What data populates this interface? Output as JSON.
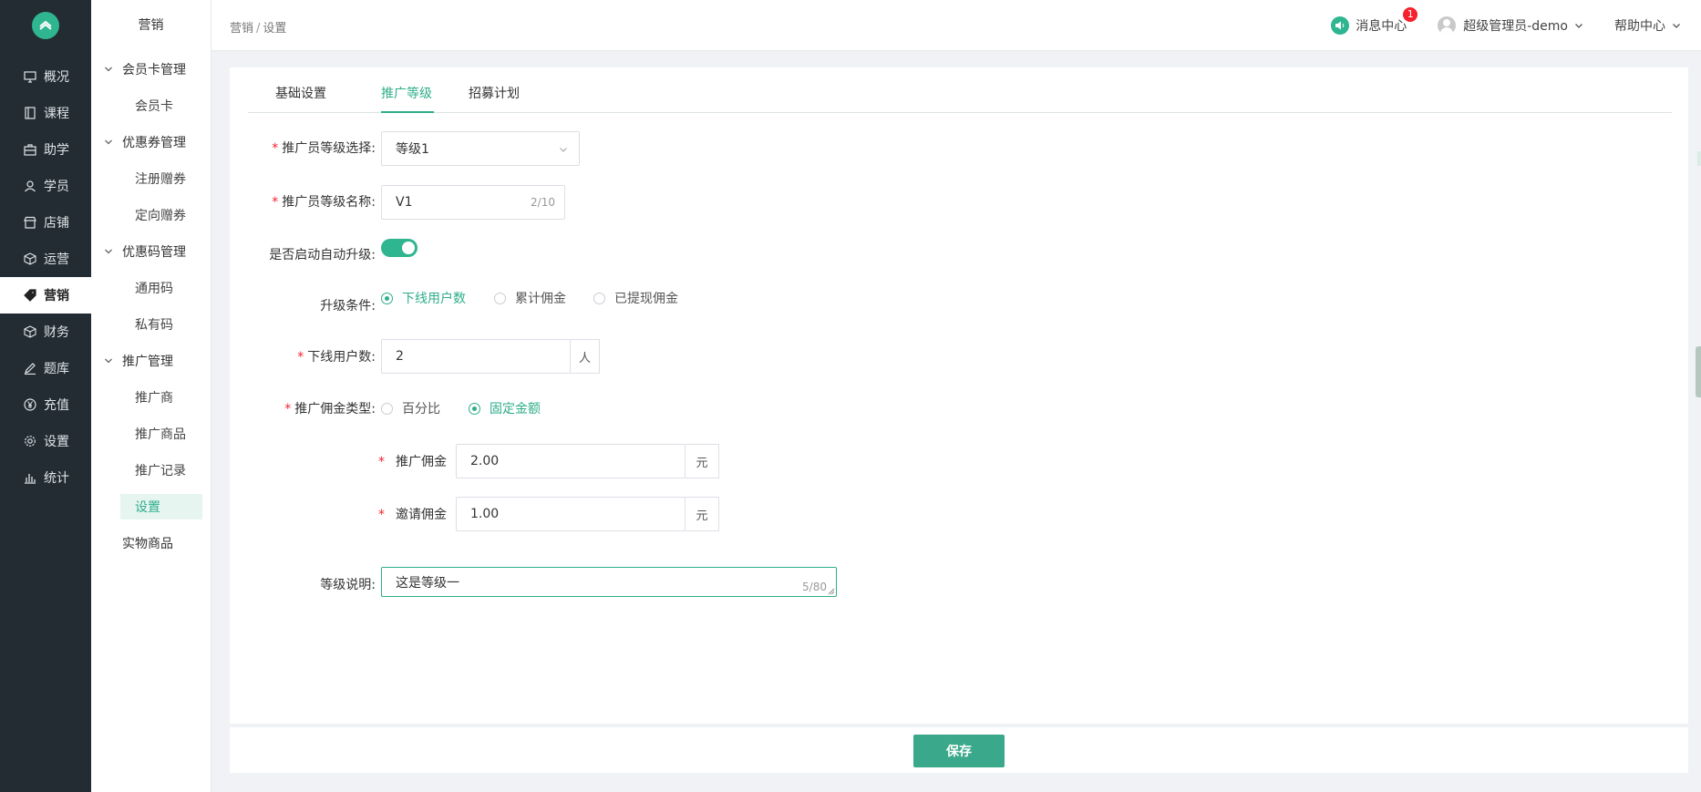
{
  "sidebar": {
    "items": [
      {
        "label": "概况",
        "icon": "monitor-icon"
      },
      {
        "label": "课程",
        "icon": "book-icon"
      },
      {
        "label": "助学",
        "icon": "briefcase-icon"
      },
      {
        "label": "学员",
        "icon": "user-icon"
      },
      {
        "label": "店铺",
        "icon": "store-icon"
      },
      {
        "label": "运营",
        "icon": "cube-icon"
      },
      {
        "label": "营销",
        "icon": "tag-icon"
      },
      {
        "label": "财务",
        "icon": "cube-icon"
      },
      {
        "label": "题库",
        "icon": "pen-icon"
      },
      {
        "label": "充值",
        "icon": "yen-icon"
      },
      {
        "label": "设置",
        "icon": "gear-icon"
      },
      {
        "label": "统计",
        "icon": "bar-chart-icon"
      }
    ],
    "active": "营销"
  },
  "submenu": {
    "title": "营销",
    "groups": [
      {
        "label": "会员卡管理",
        "items": [
          "会员卡"
        ]
      },
      {
        "label": "优惠券管理",
        "items": [
          "注册赠券",
          "定向赠券"
        ]
      },
      {
        "label": "优惠码管理",
        "items": [
          "通用码",
          "私有码"
        ]
      },
      {
        "label": "推广管理",
        "items": [
          "推广商",
          "推广商品",
          "推广记录",
          "设置"
        ]
      }
    ],
    "plain": "实物商品",
    "active_item": "设置"
  },
  "header": {
    "breadcrumb": [
      "营销",
      "设置"
    ],
    "breadcrumb_sep": "/",
    "messages": "消息中心",
    "message_badge": "1",
    "user": "超级管理员-demo",
    "help": "帮助中心"
  },
  "tabs": [
    {
      "label": "基础设置",
      "active": false
    },
    {
      "label": "推广等级",
      "active": true
    },
    {
      "label": "招募计划",
      "active": false
    }
  ],
  "form": {
    "level_select": {
      "label": "推广员等级选择:",
      "value": "等级1"
    },
    "level_name": {
      "label": "推广员等级名称:",
      "value": "V1",
      "counter": "2/10"
    },
    "auto_upgrade": {
      "label": "是否启动自动升级:",
      "on": true
    },
    "upgrade_condition": {
      "label": "升级条件:",
      "options": [
        "下线用户数",
        "累计佣金",
        "已提现佣金"
      ],
      "selected": "下线用户数"
    },
    "downline_count": {
      "label": "下线用户数:",
      "value": "2",
      "unit": "人"
    },
    "commission_type": {
      "label": "推广佣金类型:",
      "options": [
        "百分比",
        "固定金额"
      ],
      "selected": "固定金额"
    },
    "promo_commission": {
      "label": "推广佣金",
      "value": "2.00",
      "unit": "元"
    },
    "invite_commission": {
      "label": "邀请佣金",
      "value": "1.00",
      "unit": "元"
    },
    "description": {
      "label": "等级说明:",
      "value": "这是等级一",
      "counter": "5/80"
    }
  },
  "footer": {
    "save_label": "保存"
  },
  "colors": {
    "accent": "#2fae8a",
    "sidebar_bg": "#232c33",
    "required": "#f5222d"
  }
}
